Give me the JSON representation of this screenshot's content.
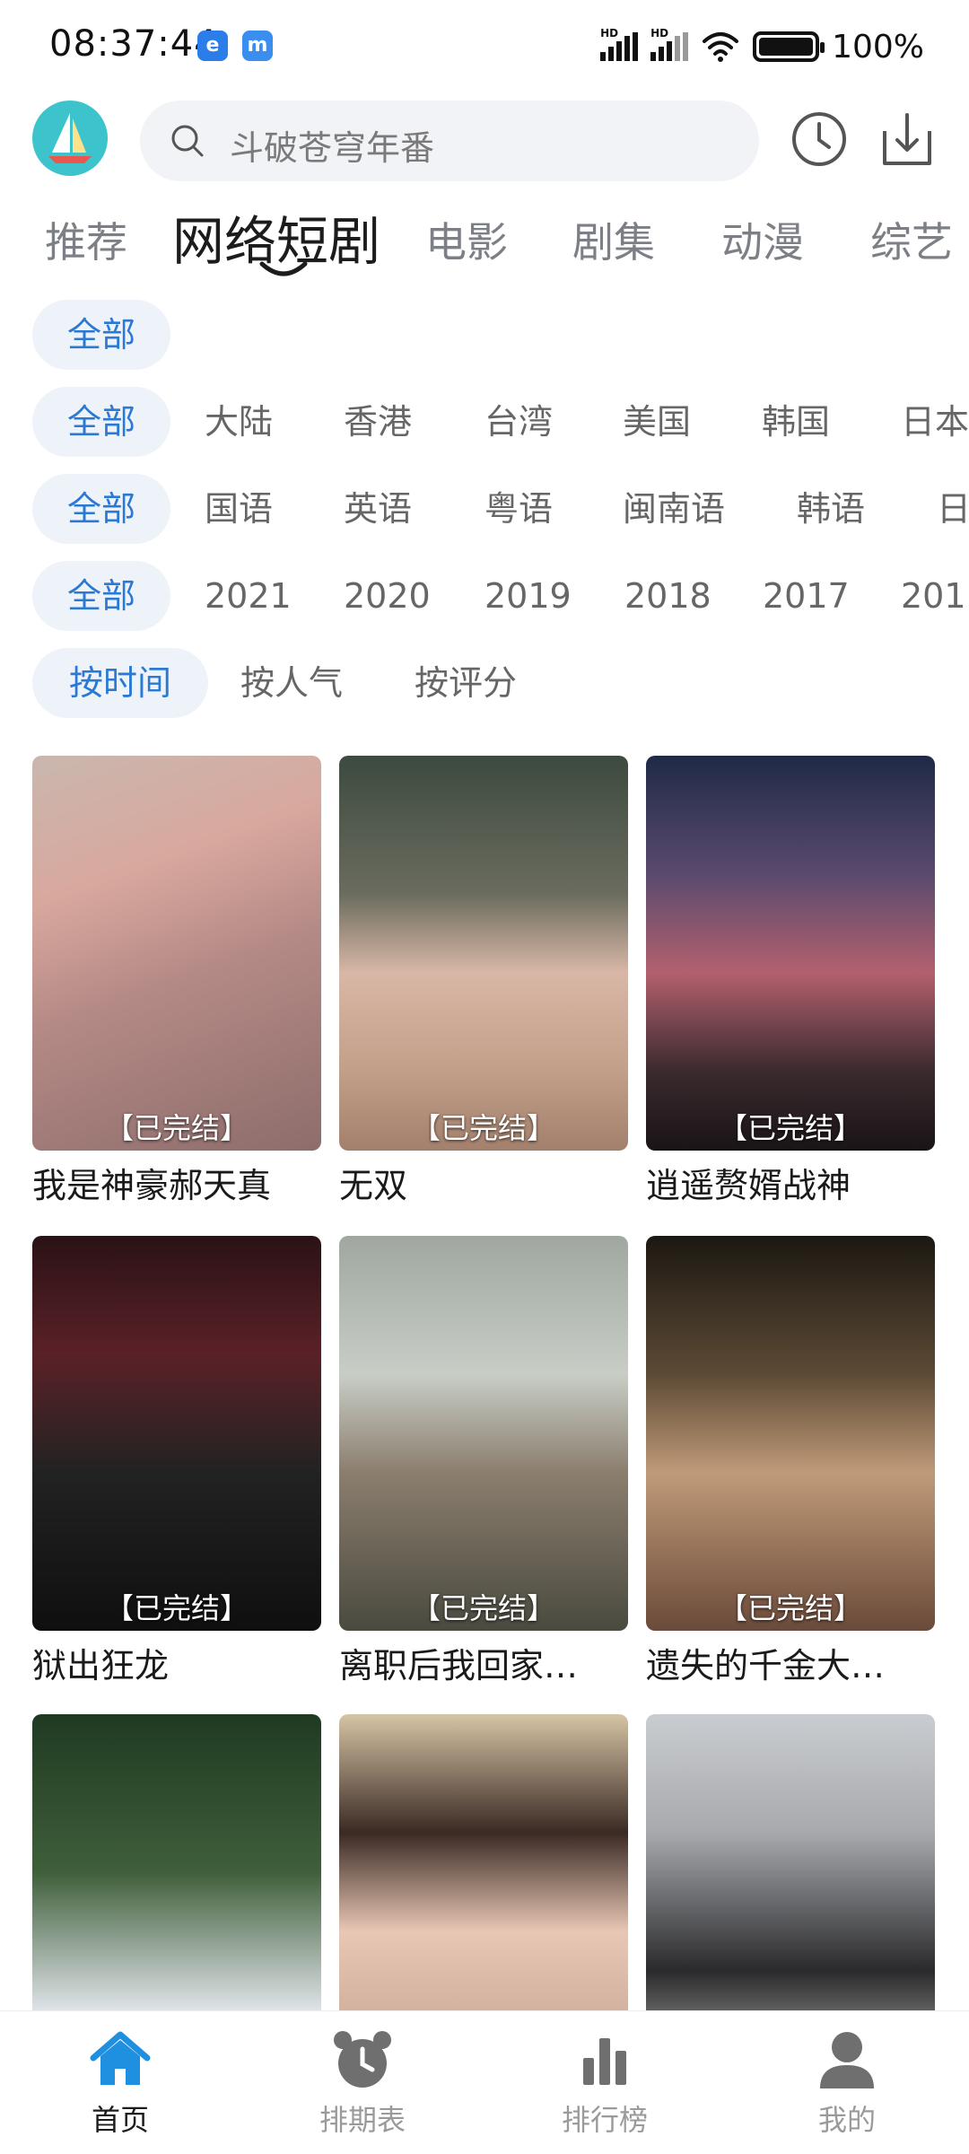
{
  "status_bar": {
    "time": "08:37:44",
    "badge1": "e",
    "badge2": "m",
    "hd1": "HD",
    "hd2": "HD",
    "battery_percent": "100%"
  },
  "header": {
    "search_placeholder": "斗破苍穹年番",
    "logo_icon": "sailboat-icon",
    "history_icon": "clock-icon",
    "download_icon": "download-icon"
  },
  "tabs": [
    {
      "label": "推荐",
      "active": false
    },
    {
      "label": "网络短剧",
      "active": true
    },
    {
      "label": "电影",
      "active": false
    },
    {
      "label": "剧集",
      "active": false
    },
    {
      "label": "动漫",
      "active": false
    },
    {
      "label": "综艺",
      "active": false
    }
  ],
  "filters": {
    "type": [
      "全部"
    ],
    "region": [
      "全部",
      "大陆",
      "香港",
      "台湾",
      "美国",
      "韩国",
      "日本"
    ],
    "language": [
      "全部",
      "国语",
      "英语",
      "粤语",
      "闽南语",
      "韩语",
      "日"
    ],
    "year": [
      "全部",
      "2021",
      "2020",
      "2019",
      "2018",
      "2017",
      "201"
    ],
    "sort": [
      "按时间",
      "按人气",
      "按评分"
    ]
  },
  "cards": [
    {
      "tag": "【已完结】",
      "title": "我是神豪郝天真"
    },
    {
      "tag": "【已完结】",
      "title": "无双"
    },
    {
      "tag": "【已完结】",
      "title": "逍遥赘婿战神"
    },
    {
      "tag": "【已完结】",
      "title": "狱出狂龙"
    },
    {
      "tag": "【已完结】",
      "title": "离职后我回家…"
    },
    {
      "tag": "【已完结】",
      "title": "遗失的千金大…"
    },
    {
      "tag": "",
      "title": ""
    },
    {
      "tag": "",
      "title": ""
    },
    {
      "tag": "",
      "title": ""
    }
  ],
  "bottom_nav": [
    {
      "label": "首页",
      "icon": "home-icon",
      "active": true
    },
    {
      "label": "排期表",
      "icon": "alarm-clock-icon",
      "active": false
    },
    {
      "label": "排行榜",
      "icon": "bar-chart-icon",
      "active": false
    },
    {
      "label": "我的",
      "icon": "profile-icon",
      "active": false
    }
  ],
  "colors": {
    "accent": "#2b79d3",
    "chip_bg": "#eef3fa",
    "tab_inactive": "#7d7f86",
    "nav_inactive": "#9a9a9a"
  }
}
